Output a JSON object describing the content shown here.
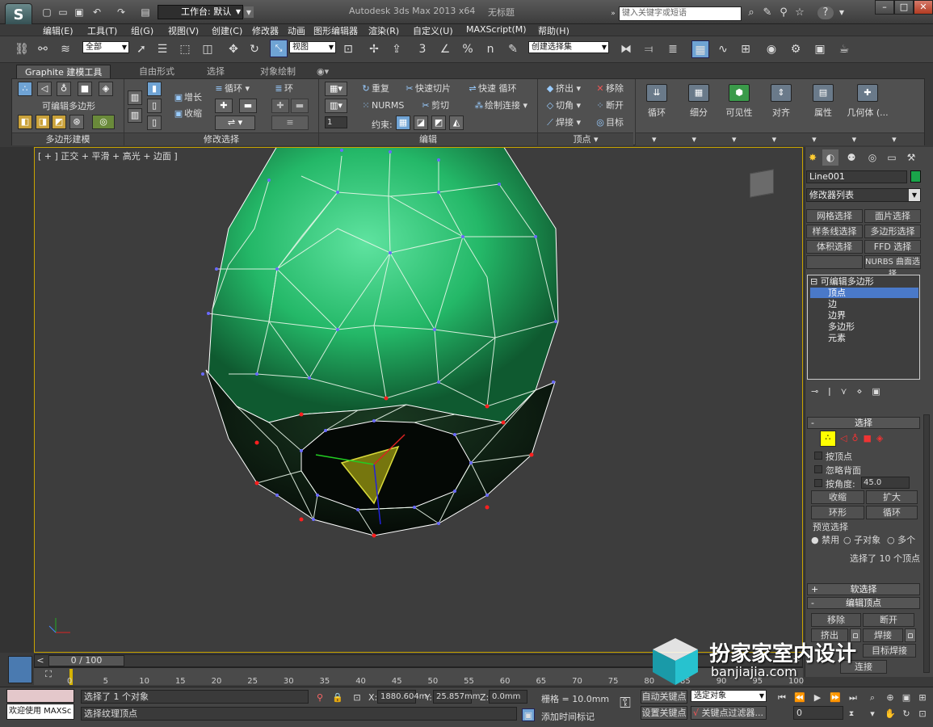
{
  "title_bar": {
    "logo": "S",
    "workspace_label": "工作台: 默认",
    "app_title": "Autodesk 3ds Max  2013 x64",
    "doc_title": "无标题",
    "search_placeholder": "键入关键字或短语",
    "help": "?"
  },
  "menu": [
    "编辑(E)",
    "工具(T)",
    "组(G)",
    "视图(V)",
    "创建(C)",
    "修改器",
    "动画",
    "图形编辑器",
    "渲染(R)",
    "自定义(U)",
    "MAXScript(M)",
    "帮助(H)"
  ],
  "main_toolbar": {
    "filter": "全部",
    "ref_coord": "视图",
    "selection_set": "创建选择集",
    "angle_snap": "3",
    "percent_snap": "%",
    "spinner_snap": "n"
  },
  "ribbon": {
    "tabs": [
      "Graphite 建模工具",
      "自由形式",
      "选择",
      "对象绘制"
    ],
    "panels": {
      "poly_modeling": {
        "title": "多边形建模",
        "editable_poly": "可编辑多边形"
      },
      "modify_selection": {
        "title": "修改选择",
        "grow": "增长",
        "shrink": "收缩",
        "loop": "循环",
        "ring": "环"
      },
      "edit": {
        "title": "编辑",
        "repeat": "重复",
        "quickslice": "快速切片",
        "quickloop": "快速 循环",
        "nurms": "NURMS",
        "cut": "剪切",
        "paint_connect": "绘制连接",
        "constraints": "约束:",
        "spinner": "1"
      },
      "vertices": {
        "title": "顶点",
        "extrude": "挤出",
        "remove": "移除",
        "chamfer": "切角",
        "break": "断开",
        "weld": "焊接",
        "target": "目标"
      },
      "big_buttons": [
        "循环",
        "细分",
        "可见性",
        "对齐",
        "属性",
        "几何体 (..."
      ]
    }
  },
  "viewport": {
    "label": "[ + ] 正交 + 平滑 + 高光 + 边面 ]"
  },
  "command_panel": {
    "object_name": "Line001",
    "object_color": "#1aa54a",
    "modifier_list": "修改器列表",
    "modifier_buttons": [
      [
        "网格选择",
        "面片选择"
      ],
      [
        "样条线选择",
        "多边形选择"
      ],
      [
        "体积选择",
        "FFD 选择"
      ],
      [
        "",
        "NURBS 曲面选择"
      ]
    ],
    "stack": {
      "root": "可编辑多边形",
      "items": [
        "顶点",
        "边",
        "边界",
        "多边形",
        "元素"
      ]
    },
    "selection": {
      "title": "选择",
      "by_vertex": "按顶点",
      "ignore_backfacing": "忽略背面",
      "by_angle": "按角度:",
      "angle": "45.0",
      "shrink": "收缩",
      "grow": "扩大",
      "ring": "环形",
      "loop": "循环",
      "preview_title": "预览选择",
      "disabled": "禁用",
      "subobject": "子对象",
      "multi": "多个",
      "status": "选择了 10 个顶点"
    },
    "soft_selection": "软选择",
    "edit_vertices": {
      "title": "编辑顶点",
      "remove": "移除",
      "break": "断开",
      "extrude": "挤出",
      "weld": "焊接",
      "target_weld": "目标焊接",
      "connect": "连接"
    }
  },
  "timeline": {
    "frame_label": "0 / 100",
    "ticks": [
      "0",
      "5",
      "10",
      "15",
      "20",
      "25",
      "30",
      "35",
      "40",
      "45",
      "50",
      "55",
      "60",
      "65",
      "70",
      "75",
      "80",
      "85",
      "90",
      "95",
      "100"
    ]
  },
  "status": {
    "welcome": "欢迎使用 MAXSc",
    "line1": "选择了 1 个对象",
    "line2": "选择纹理顶点",
    "x_label": "X:",
    "x": "1880.604m",
    "y_label": "Y:",
    "y": "25.857mm",
    "z_label": "Z:",
    "z": "0.0mm",
    "grid": "栅格 = 10.0mm",
    "auto_key": "自动关键点",
    "set_key": "设置关键点",
    "key_sel": "选定对象",
    "key_filters": "关键点过滤器...",
    "add_tag": "添加时间标记",
    "frame": "0"
  },
  "watermark": {
    "text": "扮家家室内设计",
    "url": "banjiajia.com"
  }
}
